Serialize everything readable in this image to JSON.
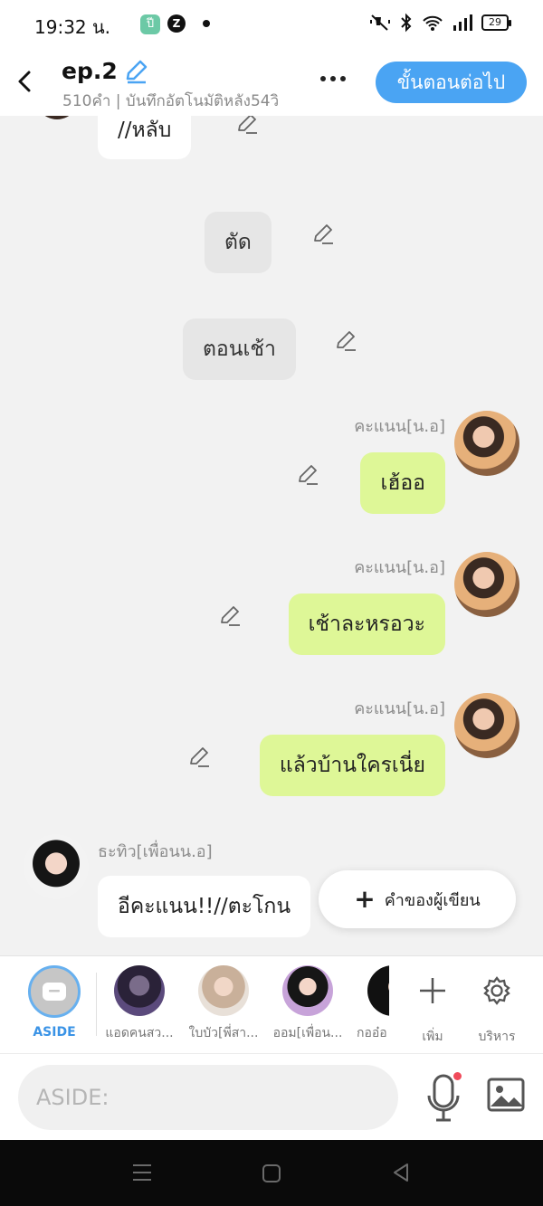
{
  "status": {
    "time": "19:32 น.",
    "battery": "29",
    "app_icon": "ปี",
    "app2": "Z"
  },
  "header": {
    "title": "ep.2",
    "subtitle": "510คำ | บันทึกอัตโนมัติหลัง54วิ",
    "next_button": "ขั้นตอนต่อไป"
  },
  "messages": [
    {
      "kind": "left",
      "text": "//หลับ"
    },
    {
      "kind": "center",
      "text": "ตัด"
    },
    {
      "kind": "center",
      "text": "ตอนเช้า"
    },
    {
      "kind": "right",
      "name": "คะแนน[น.อ]",
      "text": "เฮ้ออ"
    },
    {
      "kind": "right",
      "name": "คะแนน[น.อ]",
      "text": "เช้าละหรอวะ"
    },
    {
      "kind": "right",
      "name": "คะแนน[น.อ]",
      "text": "แล้วบ้านใครเนี่ย"
    },
    {
      "kind": "left",
      "name": "ธะทิว[เพื่อนน.อ]",
      "text": "อีคะแนน!!//ตะโกน"
    }
  ],
  "fab": {
    "label": "คำของผู้เขียน"
  },
  "characters": [
    {
      "label": "ASIDE"
    },
    {
      "label": "แอดคนสว..."
    },
    {
      "label": "ใบบัว[พี่สา..."
    },
    {
      "label": "ออม[เพื่อน..."
    },
    {
      "label": "กออ๋อ"
    }
  ],
  "actions": {
    "add": "เพิ่ม",
    "manage": "บริหาร"
  },
  "input": {
    "placeholder": "ASIDE:"
  },
  "colors": {
    "accent": "#4aa4f3",
    "bubble_self": "#def797",
    "bubble_other": "#ffffff",
    "bubble_narration": "#e6e6e6"
  }
}
